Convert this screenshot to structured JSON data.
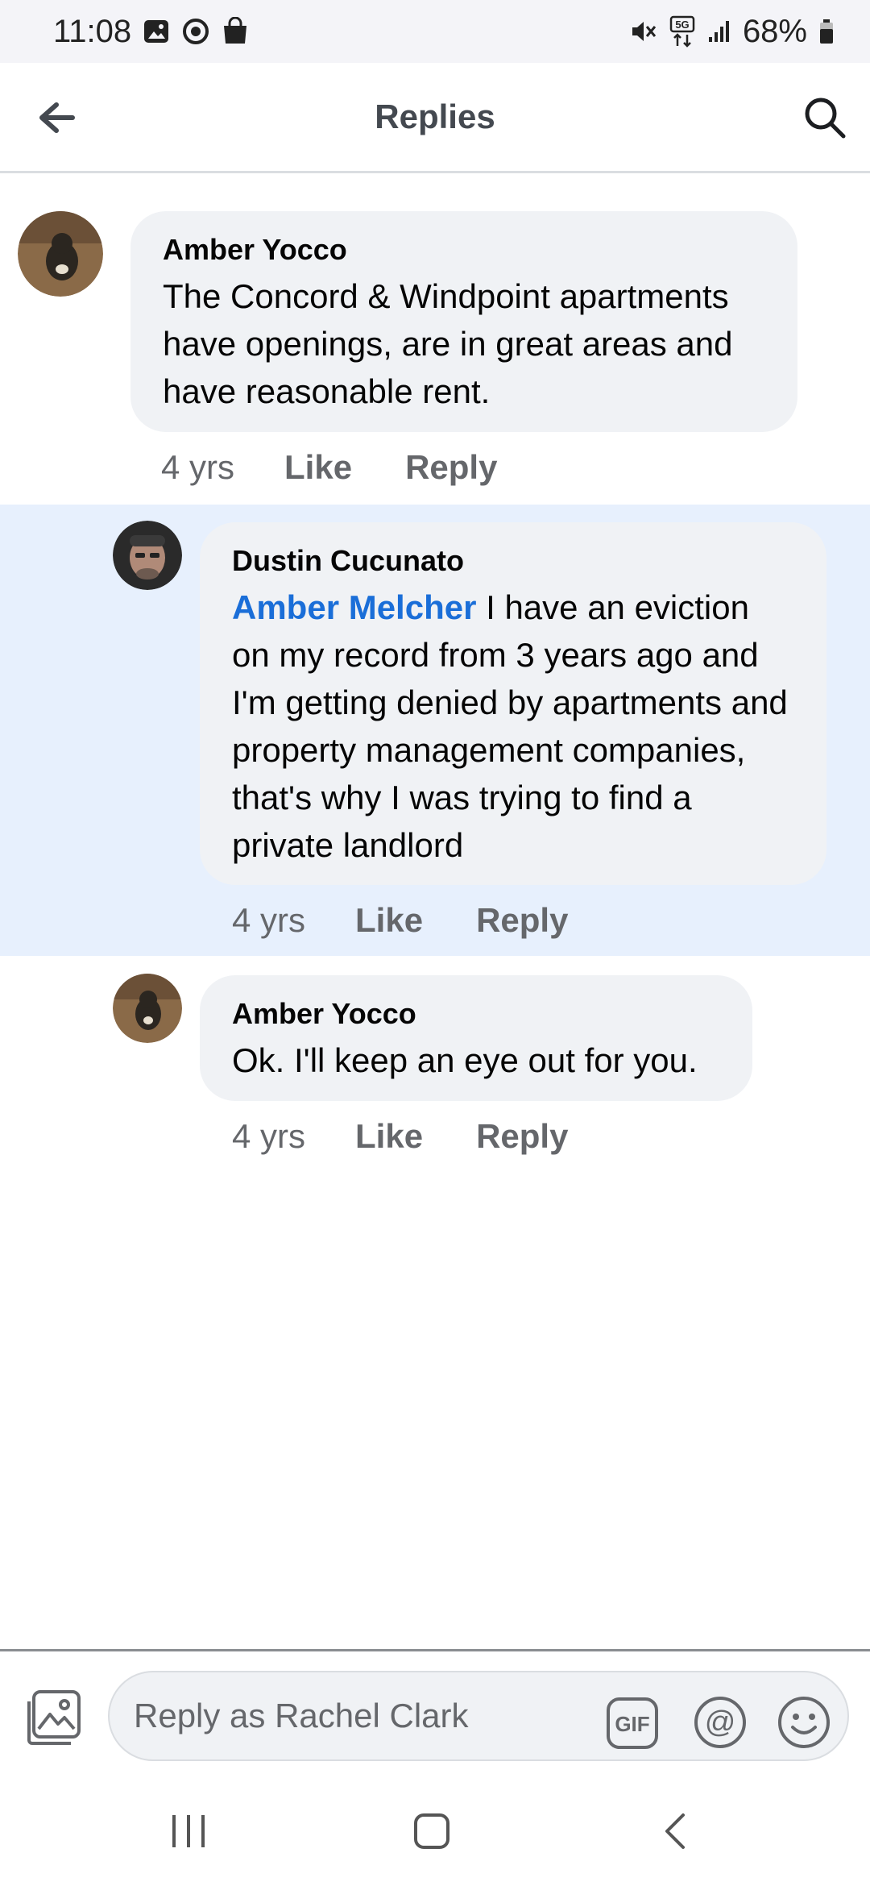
{
  "status_bar": {
    "time": "11:08",
    "battery": "68%",
    "icons_left": [
      "gallery-icon",
      "sync-icon",
      "shopping-bag-icon"
    ],
    "icons_right": [
      "mute-icon",
      "5g-icon",
      "signal-icon",
      "battery-icon"
    ]
  },
  "header": {
    "title": "Replies",
    "back_icon": "back-arrow-icon",
    "search_icon": "search-icon"
  },
  "comments": [
    {
      "author": "Amber Yocco",
      "text": "The Concord & Windpoint apartments have openings, are in great areas and have reasonable rent.",
      "time": "4 yrs",
      "like": "Like",
      "reply": "Reply"
    },
    {
      "author": "Dustin Cucunato",
      "mention": "Amber Melcher",
      "text": " I have an eviction on my record from 3 years ago and I'm getting denied by apartments and property management companies, that's why I was trying to find a private landlord",
      "time": "4 yrs",
      "like": "Like",
      "reply": "Reply",
      "highlighted": true
    },
    {
      "author": "Amber Yocco",
      "text": "Ok. I'll keep an eye out for you.",
      "time": "4 yrs",
      "like": "Like",
      "reply": "Reply"
    }
  ],
  "composer": {
    "placeholder": "Reply as Rachel Clark",
    "gif_label": "GIF",
    "at_label": "@"
  },
  "colors": {
    "highlight_bg": "#e7f0fd",
    "bubble_bg": "#f0f2f5",
    "mention": "#1a6ed8",
    "secondary_text": "#65676b"
  }
}
